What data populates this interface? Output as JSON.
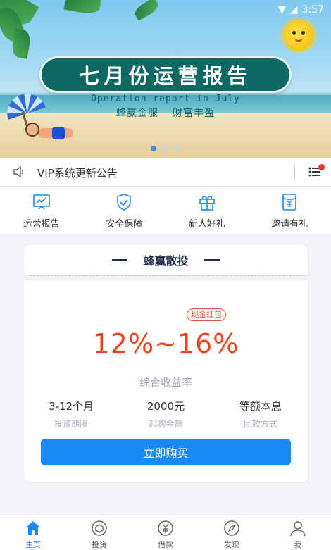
{
  "status_bar": {
    "time": "3:57"
  },
  "banner": {
    "title": "七月份运营报告",
    "subtitle_en": "Operation report in July",
    "slogan_left": "蜂赢金服",
    "slogan_right": "财富丰盈",
    "active_slide": 1,
    "slides_count": 3
  },
  "notice": {
    "text": "VIP系统更新公告",
    "has_unread": true
  },
  "quick_menu": [
    {
      "label": "运营报告",
      "icon": "report-chart-icon"
    },
    {
      "label": "安全保障",
      "icon": "shield-check-icon"
    },
    {
      "label": "新人好礼",
      "icon": "gift-icon"
    },
    {
      "label": "邀请有礼",
      "icon": "yuan-envelope-icon"
    }
  ],
  "product": {
    "title": "蜂赢散投",
    "badge": "现金红包",
    "rate": "12%~16%",
    "rate_label": "综合收益率",
    "stats": [
      {
        "value": "3-12个月",
        "label": "投资期限"
      },
      {
        "value": "2000元",
        "label": "起购金额"
      },
      {
        "value": "等额本息",
        "label": "回款方式"
      }
    ],
    "buy_label": "立即购买"
  },
  "bottom_nav": [
    {
      "label": "主页",
      "icon": "home-icon",
      "active": true
    },
    {
      "label": "投资",
      "icon": "invest-icon",
      "active": false
    },
    {
      "label": "借款",
      "icon": "loan-yuan-icon",
      "active": false
    },
    {
      "label": "发现",
      "icon": "compass-icon",
      "active": false
    },
    {
      "label": "我",
      "icon": "user-icon",
      "active": false
    }
  ],
  "colors": {
    "accent": "#1a8af5",
    "rate": "#e8451f",
    "banner_pill": "#0c6a62"
  }
}
